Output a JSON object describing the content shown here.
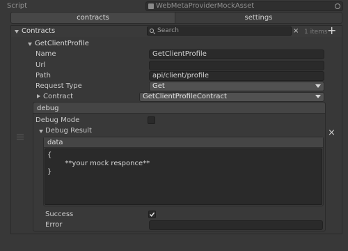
{
  "script_field": {
    "label": "Script",
    "value": "WebMetaProviderMockAsset"
  },
  "tabs": [
    {
      "label": "contracts",
      "selected": true
    },
    {
      "label": "settings",
      "selected": false
    }
  ],
  "list": {
    "title": "Contracts",
    "search_placeholder": "Search",
    "count": "1 items",
    "add_symbol": "+",
    "clear_symbol": "×",
    "remove_symbol": "×"
  },
  "item": {
    "title": "GetClientProfile",
    "fields": {
      "name_label": "Name",
      "name_value": "GetClientProfile",
      "url_label": "Url",
      "url_value": "",
      "path_label": "Path",
      "path_value": "api/client/profile",
      "request_type_label": "Request Type",
      "request_type_value": "Get",
      "contract_label": "Contract",
      "contract_value": "GetClientProfileContract"
    }
  },
  "debug": {
    "header": "debug",
    "mode_label": "Debug Mode",
    "mode_checked": false,
    "result_label": "Debug Result",
    "data_header": "data",
    "data_lines": [
      "{",
      "        **your mock responce**",
      "}"
    ],
    "success_label": "Success",
    "success_checked": true,
    "error_label": "Error",
    "error_value": ""
  },
  "colors": {
    "background": "#383838",
    "tab_selected": "#474747",
    "field_bg": "#2a2a2a",
    "dropdown_bg": "#515151"
  }
}
